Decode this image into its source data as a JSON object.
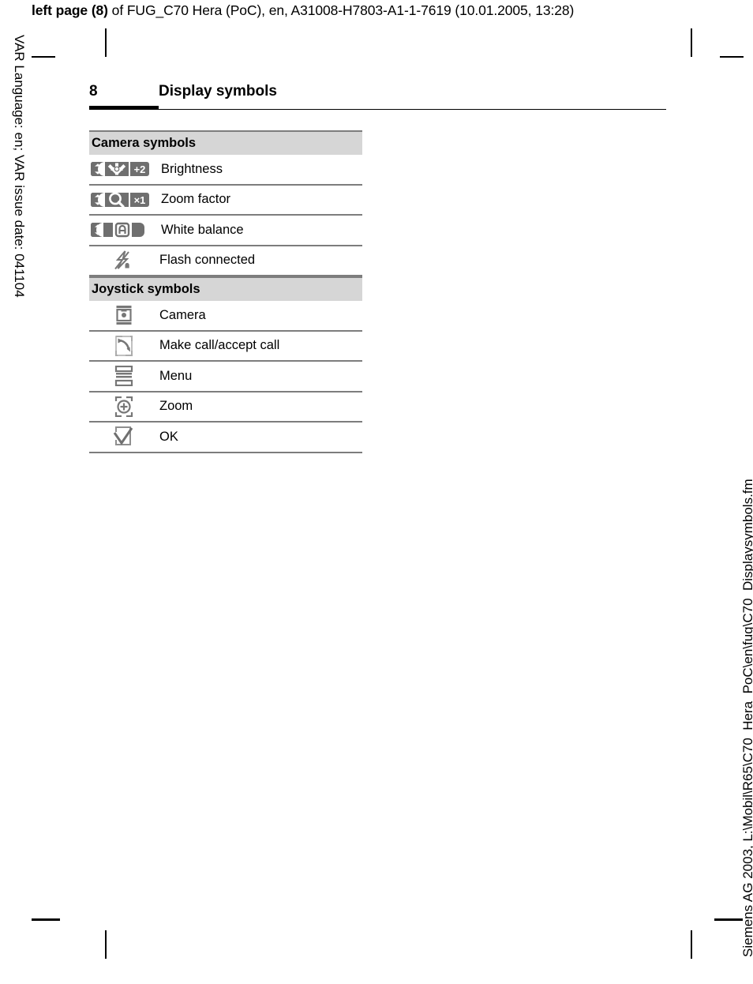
{
  "print_header": {
    "bold_prefix": "left page (8)",
    "rest": " of FUG_C70 Hera (PoC), en, A31008-H7803-A1-1-7619 (10.01.2005, 13:28)"
  },
  "side_notes": {
    "left": "VAR Language: en; VAR issue date: 041104",
    "right": "Siemens AG 2003, L:\\Mobil\\R65\\C70_Hera_PoC\\en\\fug\\C70_Displaysymbols.fm"
  },
  "page_heading": {
    "number": "8",
    "title": "Display symbols"
  },
  "colors": {
    "section_header_bg": "#d6d6d6",
    "rule": "#7d7d7d",
    "icon_gray": "#777777",
    "icon_dark": "#6f6f6f",
    "text": "#000000"
  },
  "table": {
    "sections": [
      {
        "title": "Camera symbols",
        "rows": [
          {
            "icon": "camera-brightness-icon",
            "icon_text": "+2",
            "label": "Brightness"
          },
          {
            "icon": "camera-zoom-factor-icon",
            "icon_text": "×1",
            "label": "Zoom factor"
          },
          {
            "icon": "camera-white-balance-icon",
            "icon_text": "A",
            "label": "White balance"
          },
          {
            "icon": "flash-connected-icon",
            "icon_text": "",
            "label": "Flash connected"
          }
        ]
      },
      {
        "title": "Joystick symbols",
        "rows": [
          {
            "icon": "joystick-camera-icon",
            "icon_text": "",
            "label": "Camera"
          },
          {
            "icon": "joystick-make-call-icon",
            "icon_text": "",
            "label": "Make call/accept call"
          },
          {
            "icon": "joystick-menu-icon",
            "icon_text": "",
            "label": "Menu"
          },
          {
            "icon": "joystick-zoom-icon",
            "icon_text": "",
            "label": "Zoom"
          },
          {
            "icon": "joystick-ok-icon",
            "icon_text": "",
            "label": "OK"
          }
        ]
      }
    ]
  }
}
